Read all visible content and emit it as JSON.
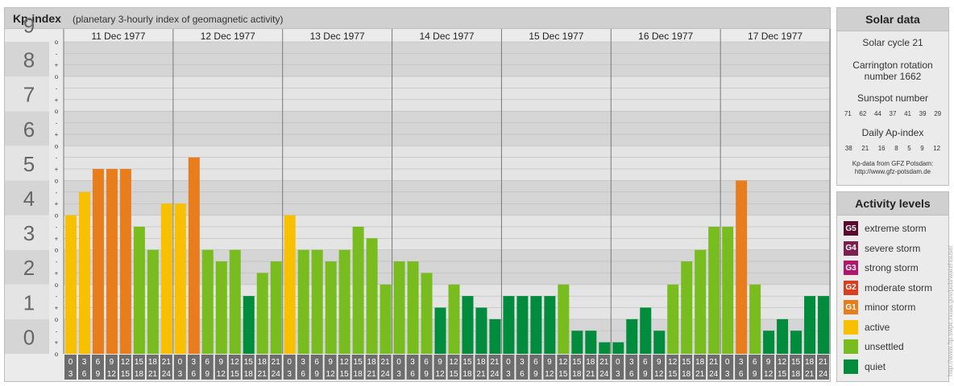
{
  "header": {
    "title": "Kp-index",
    "subtitle": "(planetary 3-hourly index of geomagnetic activity)"
  },
  "chart_data": {
    "type": "bar",
    "title": "Kp-index",
    "subtitle": "(planetary 3-hourly index of geomagnetic activity)",
    "ylim": [
      0,
      9
    ],
    "y_ticks": [
      "0",
      "1",
      "2",
      "3",
      "4",
      "5",
      "6",
      "7",
      "8",
      "9"
    ],
    "minor_tick_labels": [
      "-",
      "o",
      "+"
    ],
    "days": [
      "11 Dec 1977",
      "12 Dec 1977",
      "13 Dec 1977",
      "14 Dec 1977",
      "15 Dec 1977",
      "16 Dec 1977",
      "17 Dec 1977"
    ],
    "interval_starts": [
      "0",
      "3",
      "6",
      "9",
      "12",
      "15",
      "18",
      "21"
    ],
    "interval_ends": [
      "3",
      "6",
      "9",
      "12",
      "15",
      "18",
      "21",
      "24"
    ],
    "values": [
      4.0,
      4.667,
      5.333,
      5.333,
      5.333,
      3.667,
      3.0,
      4.333,
      4.333,
      5.667,
      3.0,
      2.667,
      3.0,
      1.667,
      2.333,
      2.667,
      4.0,
      3.0,
      3.0,
      2.667,
      3.0,
      3.667,
      3.333,
      2.0,
      2.667,
      2.667,
      2.333,
      1.333,
      2.0,
      1.667,
      1.333,
      1.0,
      1.667,
      1.667,
      1.667,
      1.667,
      2.0,
      0.667,
      0.667,
      0.333,
      0.333,
      1.0,
      1.333,
      0.667,
      2.0,
      2.667,
      3.0,
      3.667,
      3.667,
      5.0,
      2.0,
      0.667,
      1.0,
      0.667,
      1.667,
      1.667
    ],
    "grid": true,
    "legend": "right"
  },
  "solar": {
    "title": "Solar data",
    "cycle": "Solar cycle 21",
    "carrington_line1": "Carrington rotation",
    "carrington_line2": "number 1662",
    "sunspot_label": "Sunspot number",
    "sunspot_values": [
      "71",
      "62",
      "44",
      "37",
      "41",
      "39",
      "29"
    ],
    "ap_label": "Daily Ap-index",
    "ap_values": [
      "38",
      "21",
      "16",
      "8",
      "5",
      "9",
      "12"
    ],
    "credit_line1": "Kp-data from GFZ Potsdam:",
    "credit_line2": "http://www.gfz-potsdam.de"
  },
  "levels": {
    "title": "Activity levels",
    "items": [
      {
        "code": "G5",
        "label": "extreme storm",
        "color": "#5a0a2e"
      },
      {
        "code": "G4",
        "label": "severe storm",
        "color": "#7a1f4e"
      },
      {
        "code": "G3",
        "label": "strong storm",
        "color": "#b0186e"
      },
      {
        "code": "G2",
        "label": "moderate storm",
        "color": "#d93c1f"
      },
      {
        "code": "G1",
        "label": "minor storm",
        "color": "#e87d1e"
      },
      {
        "code": "",
        "label": "active",
        "color": "#f8c000"
      },
      {
        "code": "",
        "label": "unsettled",
        "color": "#78bc20"
      },
      {
        "code": "",
        "label": "quiet",
        "color": "#008c3c"
      }
    ]
  },
  "side_text": "http://www.ftp.swpc.noaa.gov/pub/warehouse/"
}
